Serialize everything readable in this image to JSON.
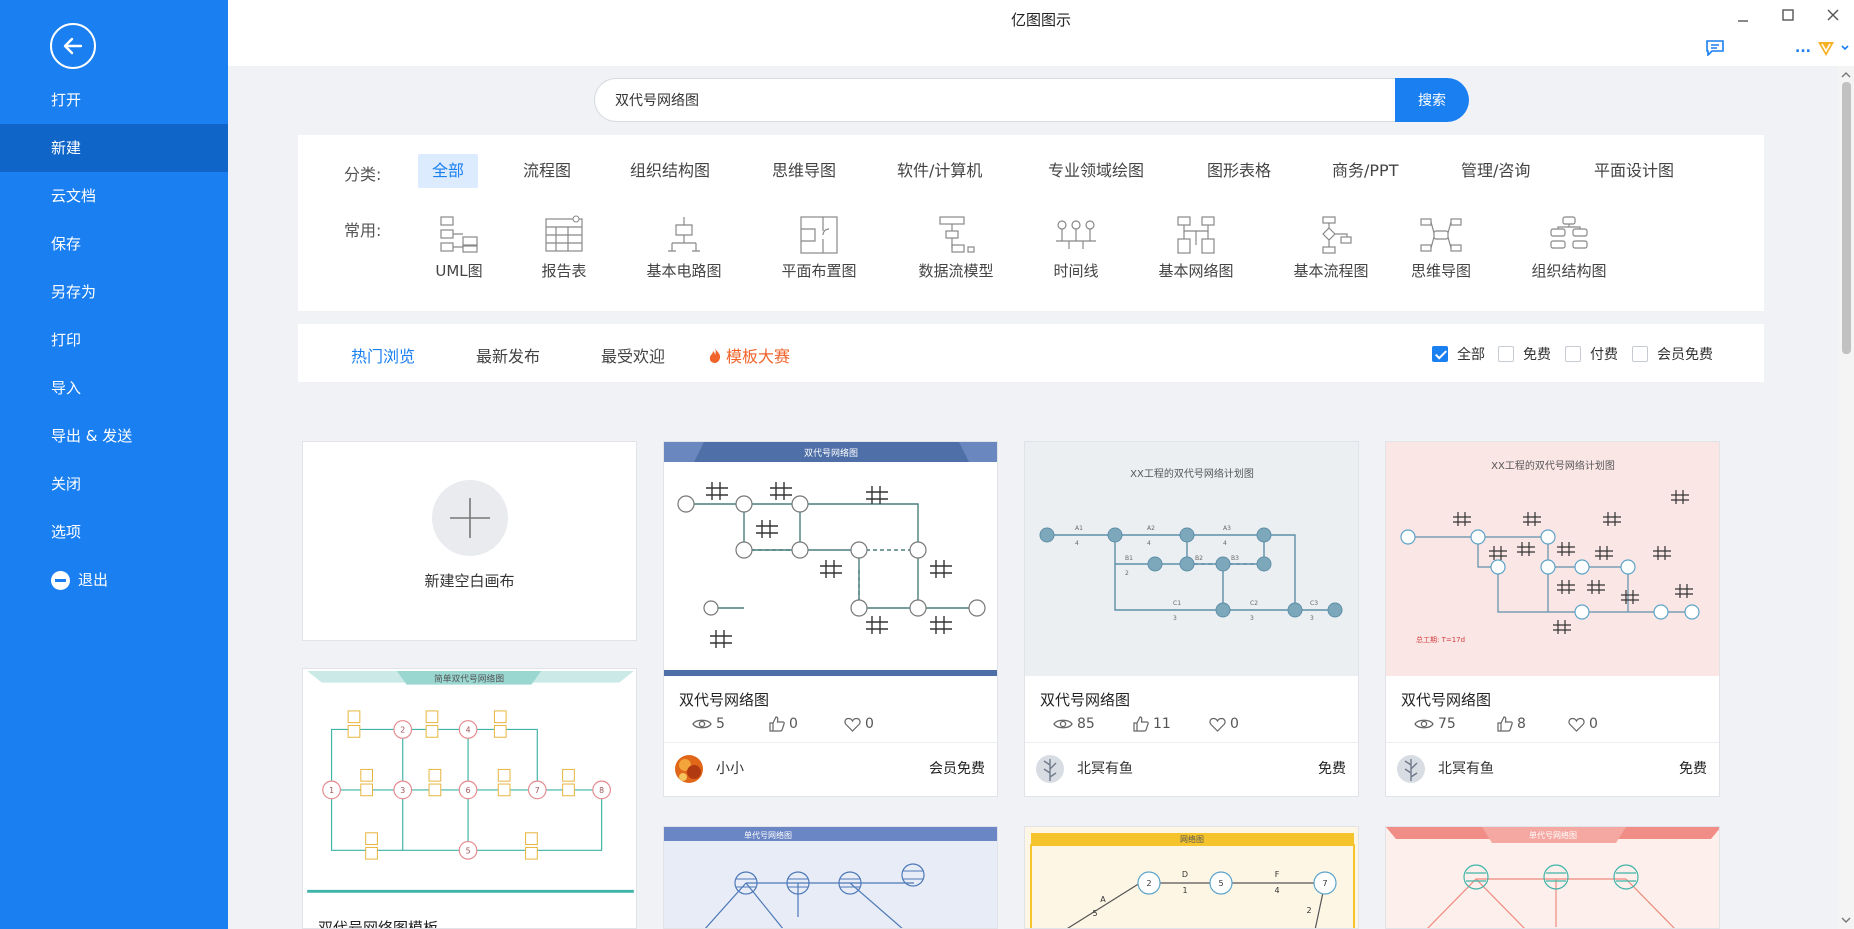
{
  "window": {
    "title": "亿图图示"
  },
  "sidebar": {
    "items": [
      {
        "label": "打开"
      },
      {
        "label": "新建"
      },
      {
        "label": "云文档"
      },
      {
        "label": "保存"
      },
      {
        "label": "另存为"
      },
      {
        "label": "打印"
      },
      {
        "label": "导入"
      },
      {
        "label": "导出 & 发送"
      },
      {
        "label": "关闭"
      },
      {
        "label": "选项"
      },
      {
        "label": "退出"
      }
    ],
    "active_index": 1
  },
  "search": {
    "value": "双代号网络图",
    "button_label": "搜索"
  },
  "categories": {
    "label": "分类:",
    "items": [
      "全部",
      "流程图",
      "组织结构图",
      "思维导图",
      "软件/计算机",
      "专业领域绘图",
      "图形表格",
      "商务/PPT",
      "管理/咨询",
      "平面设计图"
    ],
    "active_index": 0
  },
  "common": {
    "label": "常用:",
    "items": [
      "UML图",
      "报告表",
      "基本电路图",
      "平面布置图",
      "数据流模型",
      "时间线",
      "基本网络图",
      "基本流程图",
      "思维导图",
      "组织结构图"
    ]
  },
  "filter_tabs": {
    "items": [
      "热门浏览",
      "最新发布",
      "最受欢迎",
      "模板大赛"
    ],
    "active_index": 0
  },
  "price_filters": [
    {
      "label": "全部",
      "checked": true
    },
    {
      "label": "免费",
      "checked": false
    },
    {
      "label": "付费",
      "checked": false
    },
    {
      "label": "会员免费",
      "checked": false
    }
  ],
  "blank_card": {
    "label": "新建空白画布"
  },
  "cards": [
    {
      "title": "双代号网络图",
      "thumb_title": "双代号网络图",
      "views": "5",
      "likes": "0",
      "favorites": "0",
      "author": "小小",
      "price": "会员免费"
    },
    {
      "title": "双代号网络图",
      "thumb_title": "XX工程的双代号网络计划图",
      "views": "85",
      "likes": "11",
      "favorites": "0",
      "author": "北冥有鱼",
      "price": "免费"
    },
    {
      "title": "双代号网络图",
      "thumb_title": "XX工程的双代号网络计划图",
      "views": "75",
      "likes": "8",
      "favorites": "0",
      "author": "北冥有鱼",
      "price": "免费"
    }
  ],
  "left_card": {
    "title": "双代号网络图模板",
    "thumb_title": "简单双代号网络图"
  },
  "bottom_cards": [
    {
      "thumb_title": "单代号网络图"
    },
    {
      "thumb_title": "网络图"
    },
    {
      "thumb_title": "单代号网络图"
    }
  ],
  "card3_note": "总工期: T=17d",
  "colors": {
    "brand": "#1a7ff0",
    "sidebar_active": "#0f65c8",
    "hot": "#f0642c"
  }
}
